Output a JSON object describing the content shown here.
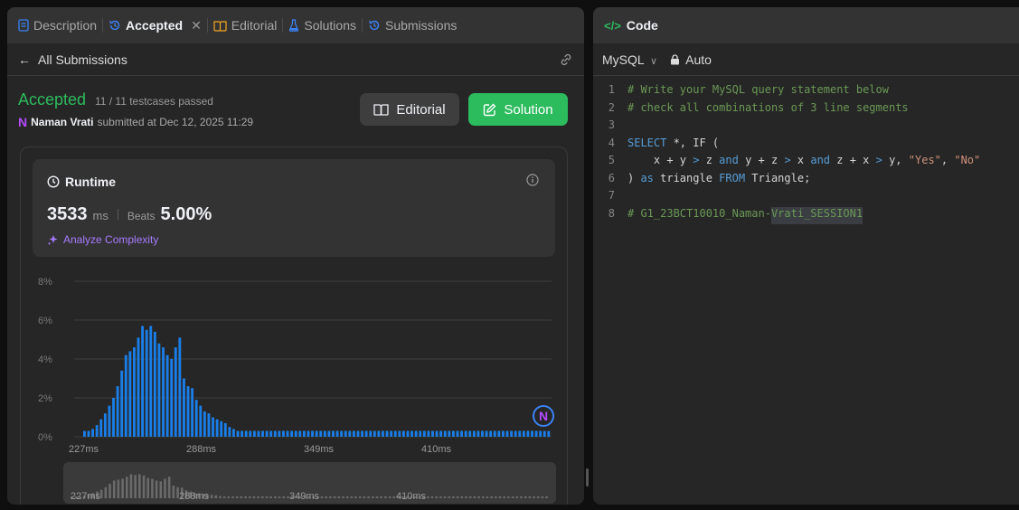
{
  "left_panel": {
    "tabs": [
      {
        "label": "Description",
        "active": false,
        "icon": "description-icon"
      },
      {
        "label": "Accepted",
        "active": true,
        "icon": "history-icon"
      },
      {
        "label": "Editorial",
        "active": false,
        "icon": "book-icon"
      },
      {
        "label": "Solutions",
        "active": false,
        "icon": "flask-icon"
      },
      {
        "label": "Submissions",
        "active": false,
        "icon": "history-icon"
      }
    ],
    "back_link": "All Submissions",
    "status": {
      "result": "Accepted",
      "testcases": "11 / 11 testcases passed",
      "user": "Naman Vrati",
      "submitted_text": "submitted at Dec 12, 2025 11:29"
    },
    "buttons": {
      "editorial": "Editorial",
      "solution": "Solution"
    },
    "runtime": {
      "title": "Runtime",
      "value": "3533",
      "unit": "ms",
      "beats_label": "Beats",
      "beats_value": "5.00%",
      "analyze": "Analyze Complexity"
    }
  },
  "chart_data": {
    "type": "bar",
    "ylim": [
      0,
      8
    ],
    "y_ticks": [
      "0%",
      "2%",
      "4%",
      "6%",
      "8%"
    ],
    "x_tick_labels": [
      "227ms",
      "288ms",
      "349ms",
      "410ms"
    ],
    "values": [
      0.3,
      0.3,
      0.4,
      0.6,
      0.9,
      1.2,
      1.6,
      2.0,
      2.6,
      3.4,
      4.2,
      4.4,
      4.6,
      5.1,
      5.7,
      5.5,
      5.7,
      5.4,
      4.8,
      4.6,
      4.2,
      4.0,
      4.6,
      5.1,
      3.0,
      2.6,
      2.5,
      1.9,
      1.6,
      1.3,
      1.2,
      1.0,
      0.9,
      0.8,
      0.7,
      0.5,
      0.4,
      0.3,
      0.3,
      0.3,
      0.3,
      0.3,
      0.3,
      0.3,
      0.3,
      0.3,
      0.3,
      0.3,
      0.3,
      0.3,
      0.3,
      0.3,
      0.3,
      0.3,
      0.3,
      0.3,
      0.3,
      0.3,
      0.3,
      0.3,
      0.3,
      0.3,
      0.3,
      0.3,
      0.3,
      0.3,
      0.3,
      0.3,
      0.3,
      0.3,
      0.3,
      0.3,
      0.3,
      0.3,
      0.3,
      0.3,
      0.3,
      0.3,
      0.3,
      0.3,
      0.3,
      0.3,
      0.3,
      0.3,
      0.3,
      0.3,
      0.3,
      0.3,
      0.3,
      0.3,
      0.3,
      0.3,
      0.3,
      0.3,
      0.3,
      0.3,
      0.3,
      0.3,
      0.3,
      0.3,
      0.3,
      0.3,
      0.3,
      0.3,
      0.3,
      0.3,
      0.3,
      0.3,
      0.3,
      0.3,
      0.3,
      0.3,
      0.3
    ],
    "bar_color": "#1a7ee8",
    "highlighted_marker": "N"
  },
  "minimap": {
    "x_tick_labels": [
      "227ms",
      "288ms",
      "349ms",
      "410ms"
    ]
  },
  "code_panel": {
    "title": "Code",
    "language": "MySQL",
    "mode": "Auto",
    "lines": [
      [
        {
          "t": "# Write your MySQL query statement below",
          "c": "c-comment"
        }
      ],
      [
        {
          "t": "# check all combinations of 3 line segments",
          "c": "c-comment"
        }
      ],
      [],
      [
        {
          "t": "SELECT",
          "c": "c-kw"
        },
        {
          "t": " *, IF (",
          "c": "c-plain"
        }
      ],
      [
        {
          "t": "    x + y ",
          "c": "c-plain"
        },
        {
          "t": ">",
          "c": "c-kw"
        },
        {
          "t": " z ",
          "c": "c-plain"
        },
        {
          "t": "and",
          "c": "c-kw"
        },
        {
          "t": " y + z ",
          "c": "c-plain"
        },
        {
          "t": ">",
          "c": "c-kw"
        },
        {
          "t": " x ",
          "c": "c-plain"
        },
        {
          "t": "and",
          "c": "c-kw"
        },
        {
          "t": " z + x ",
          "c": "c-plain"
        },
        {
          "t": ">",
          "c": "c-kw"
        },
        {
          "t": " y, ",
          "c": "c-plain"
        },
        {
          "t": "\"Yes\"",
          "c": "c-str"
        },
        {
          "t": ", ",
          "c": "c-plain"
        },
        {
          "t": "\"No\"",
          "c": "c-str"
        }
      ],
      [
        {
          "t": ") ",
          "c": "c-plain"
        },
        {
          "t": "as",
          "c": "c-kw"
        },
        {
          "t": " triangle ",
          "c": "c-plain"
        },
        {
          "t": "FROM",
          "c": "c-kw"
        },
        {
          "t": " Triangle;",
          "c": "c-plain"
        }
      ],
      [],
      [
        {
          "t": "# G1_23BCT10010_Naman-",
          "c": "c-comment"
        },
        {
          "t": "Vrati_SESSION1",
          "c": "c-comment c-hl"
        }
      ]
    ]
  }
}
